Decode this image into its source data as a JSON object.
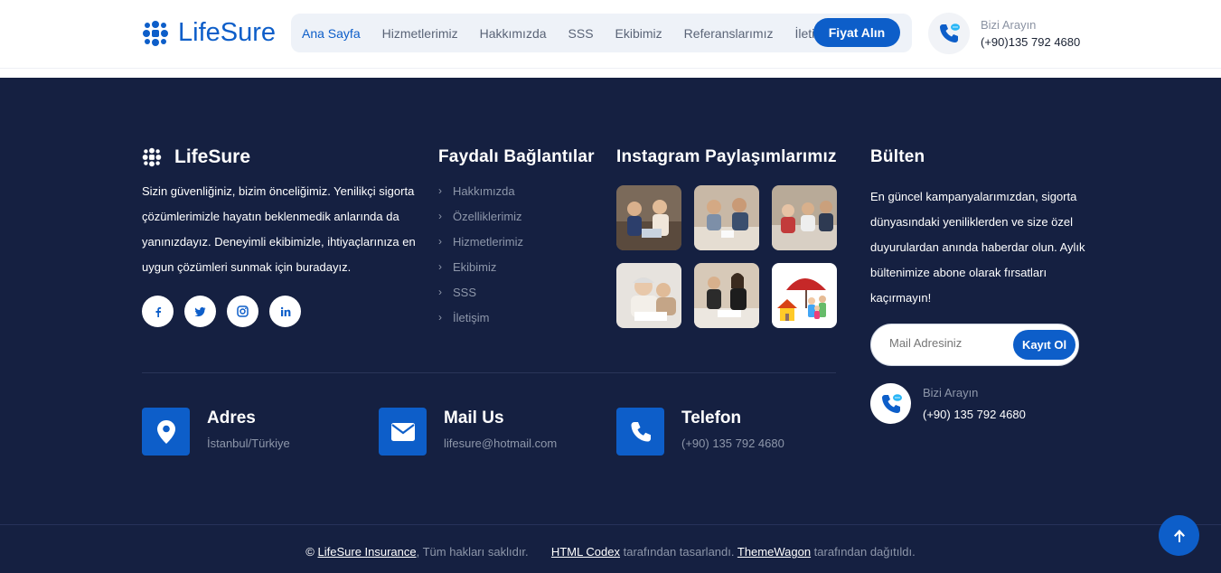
{
  "header": {
    "brand": "LifeSure",
    "nav": [
      "Ana Sayfa",
      "Hizmetlerimiz",
      "Hakkımızda",
      "SSS",
      "Ekibimiz",
      "Referanslarımız",
      "İletişim"
    ],
    "active_nav": "Ana Sayfa",
    "cta_label": "Fiyat Alın",
    "call_label": "Bizi Arayın",
    "call_number": "(+90)135 792 4680",
    "icons": [
      "logo-mark-icon",
      "phone-chat-icon"
    ]
  },
  "footer": {
    "brand": "LifeSure",
    "about": "Sizin güvenliğiniz, bizim önceliğimiz. Yenilikçi sigorta çözümlerimizle hayatın beklenmedik anlarında da yanınızdayız. Deneyimli ekibimizle, ihtiyaçlarınıza en uygun çözümleri sunmak için buradayız.",
    "socials": [
      "facebook-icon",
      "twitter-icon",
      "instagram-icon",
      "linkedin-icon"
    ],
    "links_title": "Faydalı Bağlantılar",
    "links": [
      "Hakkımızda",
      "Özelliklerimiz",
      "Hizmetlerimiz",
      "Ekibimiz",
      "SSS",
      "İletişim"
    ],
    "instagram_title": "Instagram Paylaşımlarımız",
    "newsletter_title": "Bülten",
    "newsletter_text": "En güncel kampanyalarımızdan, sigorta dünyasındaki yeniliklerden ve size özel duyurulardan anında haberdar olun. Aylık bültenimize abone olarak fırsatları kaçırmayın!",
    "email_placeholder": "Mail Adresiniz",
    "subscribe_label": "Kayıt Ol",
    "call_label": "Bizi Arayın",
    "call_number": "(+90) 135 792 4680",
    "contacts": [
      {
        "title": "Adres",
        "value": "İstanbul/Türkiye"
      },
      {
        "title": "Mail Us",
        "value": "lifesure@hotmail.com"
      },
      {
        "title": "Telefon",
        "value": "(+90) 135 792 4680"
      }
    ],
    "copyright": {
      "brand_link": "LifeSure Insurance",
      "rights": ", Tüm hakları saklıdır.",
      "designer_link": "HTML Codex",
      "designer_text": " tarafından tasarlandı.",
      "distributor_link": "ThemeWagon",
      "distributor_text": " tarafından dağıtıldı."
    }
  },
  "colors": {
    "accent": "#0d5ec9",
    "footer_bg": "#152041",
    "muted": "#8e97aa"
  }
}
